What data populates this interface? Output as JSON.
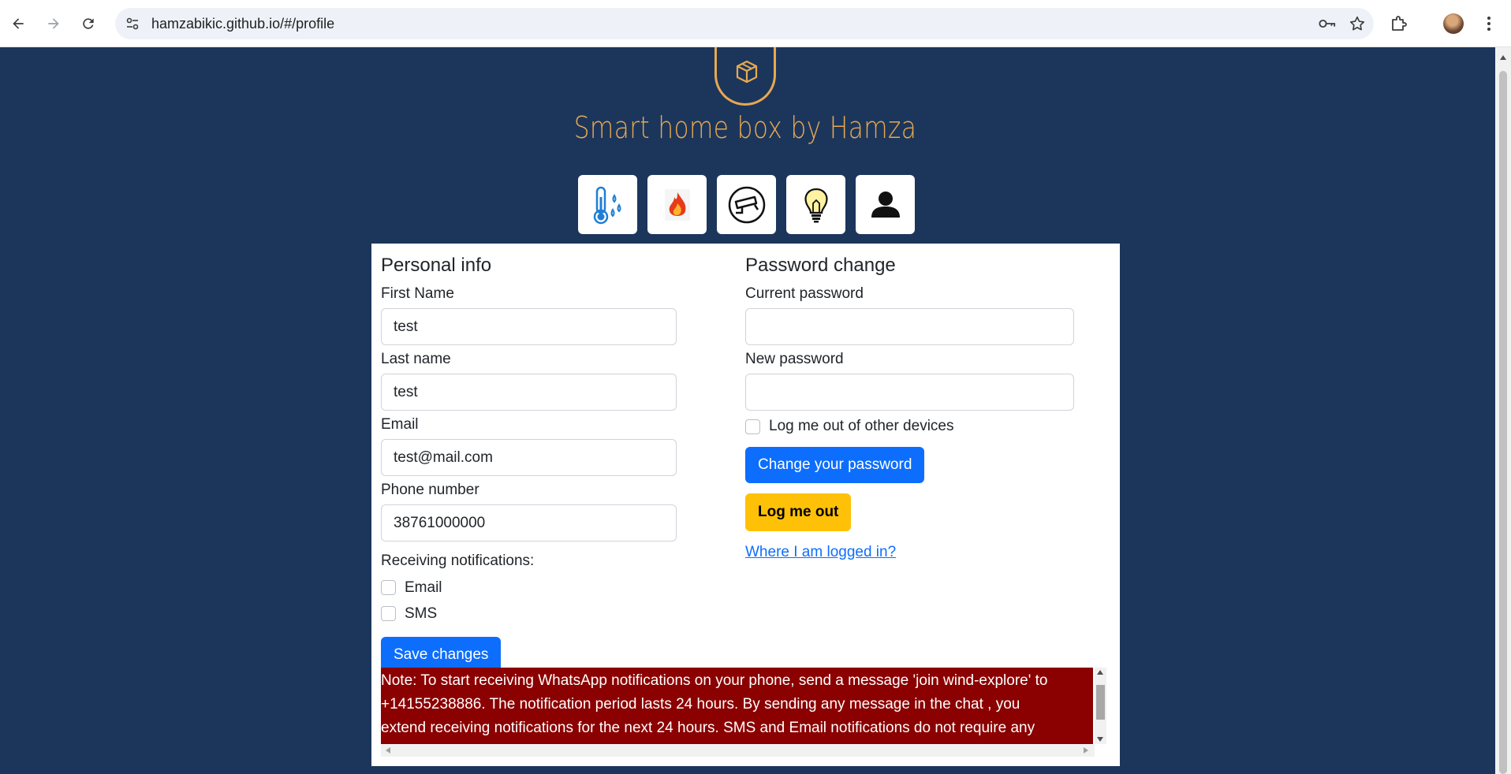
{
  "browser": {
    "url": "hamzabikic.github.io/#/profile",
    "icons": [
      "back-icon",
      "forward-icon",
      "reload-icon",
      "site-settings-icon",
      "password-key-icon",
      "bookmark-star-icon",
      "extensions-icon",
      "profile-avatar",
      "more-menu-icon"
    ]
  },
  "header": {
    "title": "Smart home box by Hamza",
    "logo_icon": "box-icon",
    "accent_color": "#e8a852",
    "background_color": "#1c365b"
  },
  "nav_tiles": [
    {
      "name": "temperature-humidity-icon"
    },
    {
      "name": "fire-icon"
    },
    {
      "name": "security-camera-icon"
    },
    {
      "name": "light-bulb-icon"
    },
    {
      "name": "user-profile-icon"
    }
  ],
  "personal_info": {
    "heading": "Personal info",
    "first_name_label": "First Name",
    "first_name_value": "test",
    "last_name_label": "Last name",
    "last_name_value": "test",
    "email_label": "Email",
    "email_value": "test@mail.com",
    "phone_label": "Phone number",
    "phone_value": "38761000000",
    "notifications_label": "Receiving notifications:",
    "notif_email_label": "Email",
    "notif_sms_label": "SMS",
    "save_label": "Save changes"
  },
  "password_change": {
    "heading": "Password change",
    "current_label": "Current password",
    "current_value": "",
    "new_label": "New password",
    "new_value": "",
    "logout_others_label": "Log me out of other devices",
    "change_button": "Change your password",
    "logout_button": "Log me out",
    "where_link": "Where I am logged in?"
  },
  "note": {
    "line1": "Note: To start receiving WhatsApp notifications on your phone, send a message 'join wind-explore' to",
    "line2": "+14155238886. The notification period lasts 24 hours. By sending any message in the chat , you",
    "line3": "extend receiving notifications for the next 24 hours. SMS and Email notifications do not require any",
    "background_color": "#8b0000"
  },
  "colors": {
    "primary_button": "#0d6efd",
    "warning_button": "#ffc107"
  }
}
